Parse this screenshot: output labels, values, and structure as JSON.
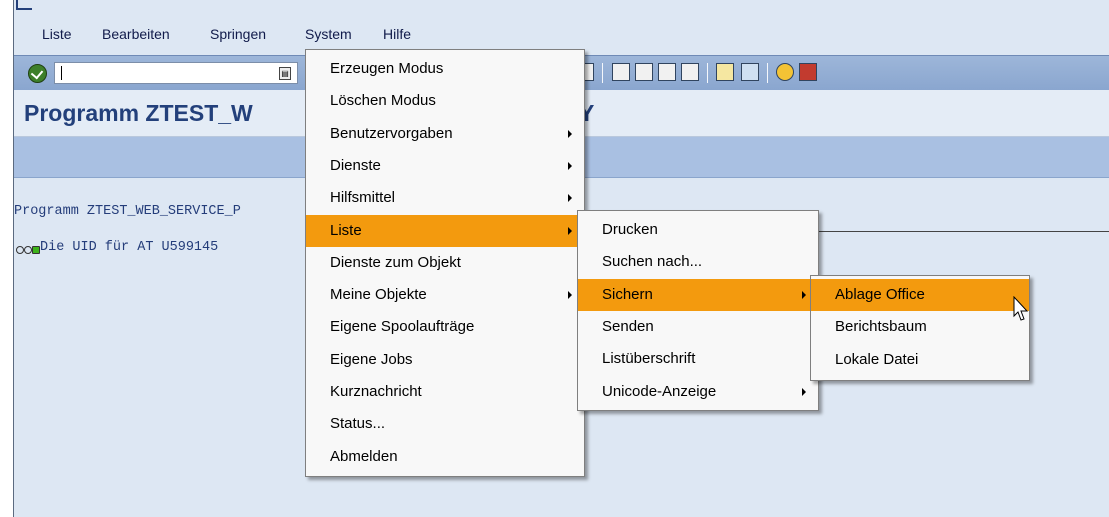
{
  "menubar": {
    "items": [
      "Liste",
      "Bearbeiten",
      "Springen",
      "System",
      "Hilfe"
    ]
  },
  "page": {
    "title": "Programm ZTEST_W",
    "title_tail": "Y"
  },
  "list": {
    "header": "Programm ZTEST_WEB_SERVICE_P",
    "line": "Die UID für  AT U599145"
  },
  "system_menu": {
    "items": [
      {
        "label": "Erzeugen Modus",
        "submenu": false,
        "selected": false
      },
      {
        "label": "Löschen Modus",
        "submenu": false,
        "selected": false
      },
      {
        "label": "Benutzervorgaben",
        "submenu": true,
        "selected": false
      },
      {
        "label": "Dienste",
        "submenu": true,
        "selected": false
      },
      {
        "label": "Hilfsmittel",
        "submenu": true,
        "selected": false
      },
      {
        "label": "Liste",
        "submenu": true,
        "selected": true
      },
      {
        "label": "Dienste zum Objekt",
        "submenu": false,
        "selected": false
      },
      {
        "label": "Meine Objekte",
        "submenu": true,
        "selected": false
      },
      {
        "label": "Eigene Spoolaufträge",
        "submenu": false,
        "selected": false
      },
      {
        "label": "Eigene Jobs",
        "submenu": false,
        "selected": false
      },
      {
        "label": "Kurznachricht",
        "submenu": false,
        "selected": false
      },
      {
        "label": "Status...",
        "submenu": false,
        "selected": false
      },
      {
        "label": "Abmelden",
        "submenu": false,
        "selected": false
      }
    ]
  },
  "liste_menu": {
    "items": [
      {
        "label": "Drucken",
        "submenu": false,
        "selected": false
      },
      {
        "label": "Suchen nach...",
        "submenu": false,
        "selected": false
      },
      {
        "label": "Sichern",
        "submenu": true,
        "selected": true
      },
      {
        "label": "Senden",
        "submenu": false,
        "selected": false
      },
      {
        "label": "Listüberschrift",
        "submenu": false,
        "selected": false
      },
      {
        "label": "Unicode-Anzeige",
        "submenu": true,
        "selected": false
      }
    ]
  },
  "sichern_menu": {
    "items": [
      {
        "label": "Ablage Office",
        "submenu": false,
        "selected": true
      },
      {
        "label": "Berichtsbaum",
        "submenu": false,
        "selected": false
      },
      {
        "label": "Lokale Datei",
        "submenu": false,
        "selected": false
      }
    ]
  },
  "colors": {
    "highlight": "#f39a0e",
    "title": "#23407b",
    "toolbar": "#9db6d9"
  },
  "icons": [
    "enter-icon",
    "command-field-dropdown-icon",
    "print-icon",
    "find-icon",
    "first-page-icon",
    "prev-page-icon",
    "next-page-icon",
    "last-page-icon",
    "new-session-icon",
    "shortcut-icon",
    "help-icon",
    "layout-icon",
    "mouse-cursor-icon"
  ]
}
